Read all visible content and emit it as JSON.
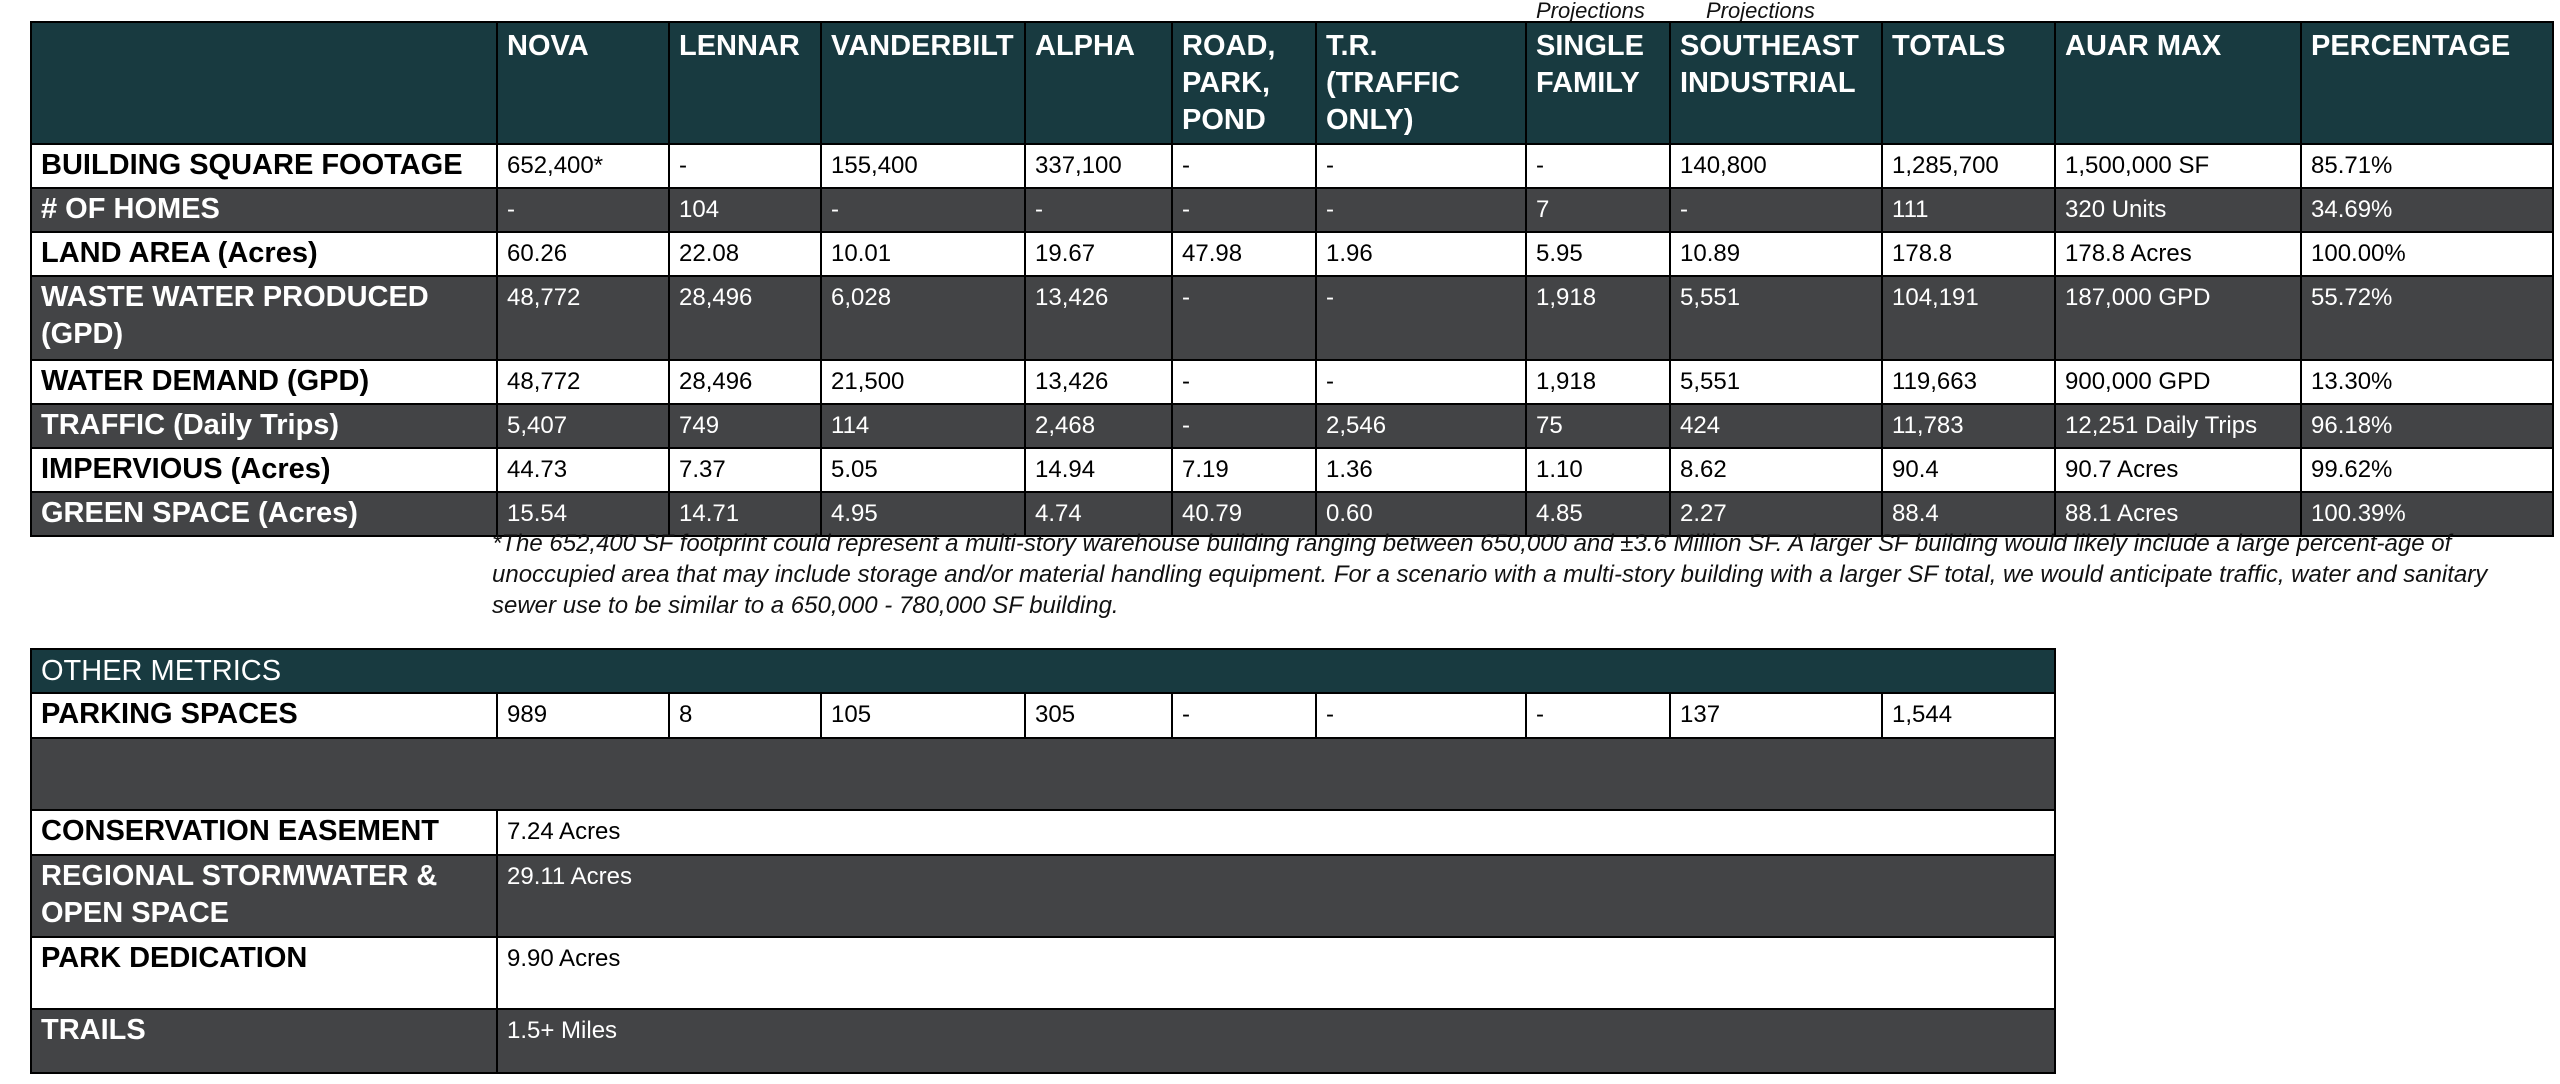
{
  "projections": [
    "Projections",
    "Projections"
  ],
  "columns": [
    "NOVA",
    "LENNAR",
    "VANDERBILT",
    "ALPHA",
    "ROAD, PARK, POND",
    "T.R. (TRAFFIC ONLY)",
    "SINGLE FAMILY",
    "SOUTHEAST INDUSTRIAL",
    "TOTALS",
    "AUAR MAX",
    "PERCENTAGE"
  ],
  "rows": [
    {
      "label": "BUILDING SQUARE FOOTAGE",
      "values": [
        "652,400*",
        "-",
        "155,400",
        "337,100",
        "-",
        "-",
        "-",
        "140,800",
        "1,285,700",
        "1,500,000 SF",
        "85.71%"
      ]
    },
    {
      "label": "# OF HOMES",
      "values": [
        "-",
        "104",
        "-",
        "-",
        "-",
        "-",
        "7",
        "-",
        "111",
        "320 Units",
        "34.69%"
      ]
    },
    {
      "label": "LAND AREA (Acres)",
      "values": [
        "60.26",
        "22.08",
        "10.01",
        "19.67",
        "47.98",
        "1.96",
        "5.95",
        "10.89",
        "178.8",
        "178.8 Acres",
        "100.00%"
      ]
    },
    {
      "label": "WASTE WATER PRODUCED (GPD)",
      "values": [
        "48,772",
        "28,496",
        "6,028",
        "13,426",
        "-",
        "-",
        "1,918",
        "5,551",
        "104,191",
        "187,000 GPD",
        "55.72%"
      ]
    },
    {
      "label": "WATER DEMAND (GPD)",
      "values": [
        "48,772",
        "28,496",
        "21,500",
        "13,426",
        "-",
        "-",
        "1,918",
        "5,551",
        "119,663",
        "900,000 GPD",
        "13.30%"
      ]
    },
    {
      "label": "TRAFFIC (Daily Trips)",
      "values": [
        "5,407",
        "749",
        "114",
        "2,468",
        "-",
        "2,546",
        "75",
        "424",
        "11,783",
        "12,251 Daily Trips",
        "96.18%"
      ]
    },
    {
      "label": "IMPERVIOUS (Acres)",
      "values": [
        "44.73",
        "7.37",
        "5.05",
        "14.94",
        "7.19",
        "1.36",
        "1.10",
        "8.62",
        "90.4",
        "90.7 Acres",
        "99.62%"
      ]
    },
    {
      "label": "GREEN SPACE (Acres)",
      "values": [
        "15.54",
        "14.71",
        "4.95",
        "4.74",
        "40.79",
        "0.60",
        "4.85",
        "2.27",
        "88.4",
        "88.1 Acres",
        "100.39%"
      ]
    }
  ],
  "footnote": "*The 652,400 SF footprint could represent a multi-story warehouse building ranging between 650,000 and ±3.6 Million SF. A larger SF building would likely include a large percent-age of unoccupied area that may include storage and/or material handling equipment. For a scenario with a multi-story building with a larger SF total, we would anticipate traffic, water and sanitary sewer use to be similar to a 650,000 - 780,000 SF building.",
  "other_metrics": {
    "title": "OTHER METRICS",
    "parking": {
      "label": "PARKING SPACES",
      "values": [
        "989",
        "8",
        "105",
        "305",
        "-",
        "-",
        "-",
        "137",
        "1,544"
      ]
    },
    "items": [
      {
        "label": "CONSERVATION EASEMENT",
        "value": "7.24 Acres"
      },
      {
        "label": "REGIONAL STORMWATER & OPEN SPACE",
        "value": "29.11 Acres"
      },
      {
        "label": "PARK DEDICATION",
        "value": "9.90 Acres"
      },
      {
        "label": "TRAILS",
        "value": "1.5+ Miles"
      }
    ]
  },
  "colors": {
    "header_bg": "#183a40",
    "dark_row_bg": "#434446",
    "light_row_bg": "#ffffff",
    "border": "#000000"
  }
}
